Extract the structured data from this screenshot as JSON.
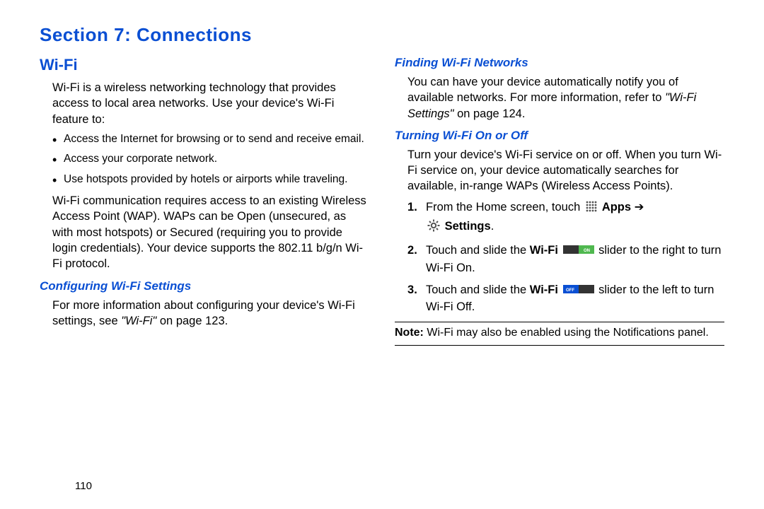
{
  "section_title": "Section 7: Connections",
  "page_number": "110",
  "left": {
    "heading": "Wi-Fi",
    "intro": "Wi-Fi is a wireless networking technology that provides access to local area networks. Use your device's Wi-Fi feature to:",
    "bullets": [
      "Access the Internet for browsing or to send and receive email.",
      "Access your corporate network.",
      "Use hotspots provided by hotels or airports while traveling."
    ],
    "para2": "Wi-Fi communication requires access to an existing Wireless Access Point (WAP). WAPs can be Open (unsecured, as with most hotspots) or Secured (requiring you to provide login credentials). Your device supports the 802.11 b/g/n Wi-Fi protocol.",
    "sub_heading": "Configuring Wi-Fi Settings",
    "config_a": "For more information about configuring your device's Wi-Fi settings, see ",
    "config_ref": "\"Wi-Fi\"",
    "config_b": " on page 123."
  },
  "right": {
    "sub1": "Finding Wi-Fi Networks",
    "find_a": "You can have your device automatically notify you of available networks. For more information, refer to ",
    "find_ref": "\"Wi-Fi Settings\"",
    "find_b": "  on page 124.",
    "sub2": "Turning Wi-Fi On or Off",
    "turn_intro": "Turn your device's Wi-Fi service on or off. When you turn Wi-Fi service on, your device automatically searches for available, in-range WAPs (Wireless Access Points).",
    "step1_a": "From the Home screen, touch ",
    "step1_apps": " Apps ",
    "step1_arrow": "➔",
    "step1_settings": "Settings",
    "step1_end": ".",
    "step2_a": "Touch and slide the ",
    "step2_wifi": "Wi-Fi",
    "step2_b": " slider to the right to turn Wi-Fi On.",
    "step3_a": "Touch and slide the ",
    "step3_wifi": "Wi-Fi",
    "step3_b": " slider to the left to turn Wi-Fi Off.",
    "note_label": "Note:",
    "note_text": " Wi-Fi may also be enabled using the Notifications panel."
  },
  "icons": {
    "slider_on_label": "ON",
    "slider_off_label": "OFF"
  }
}
